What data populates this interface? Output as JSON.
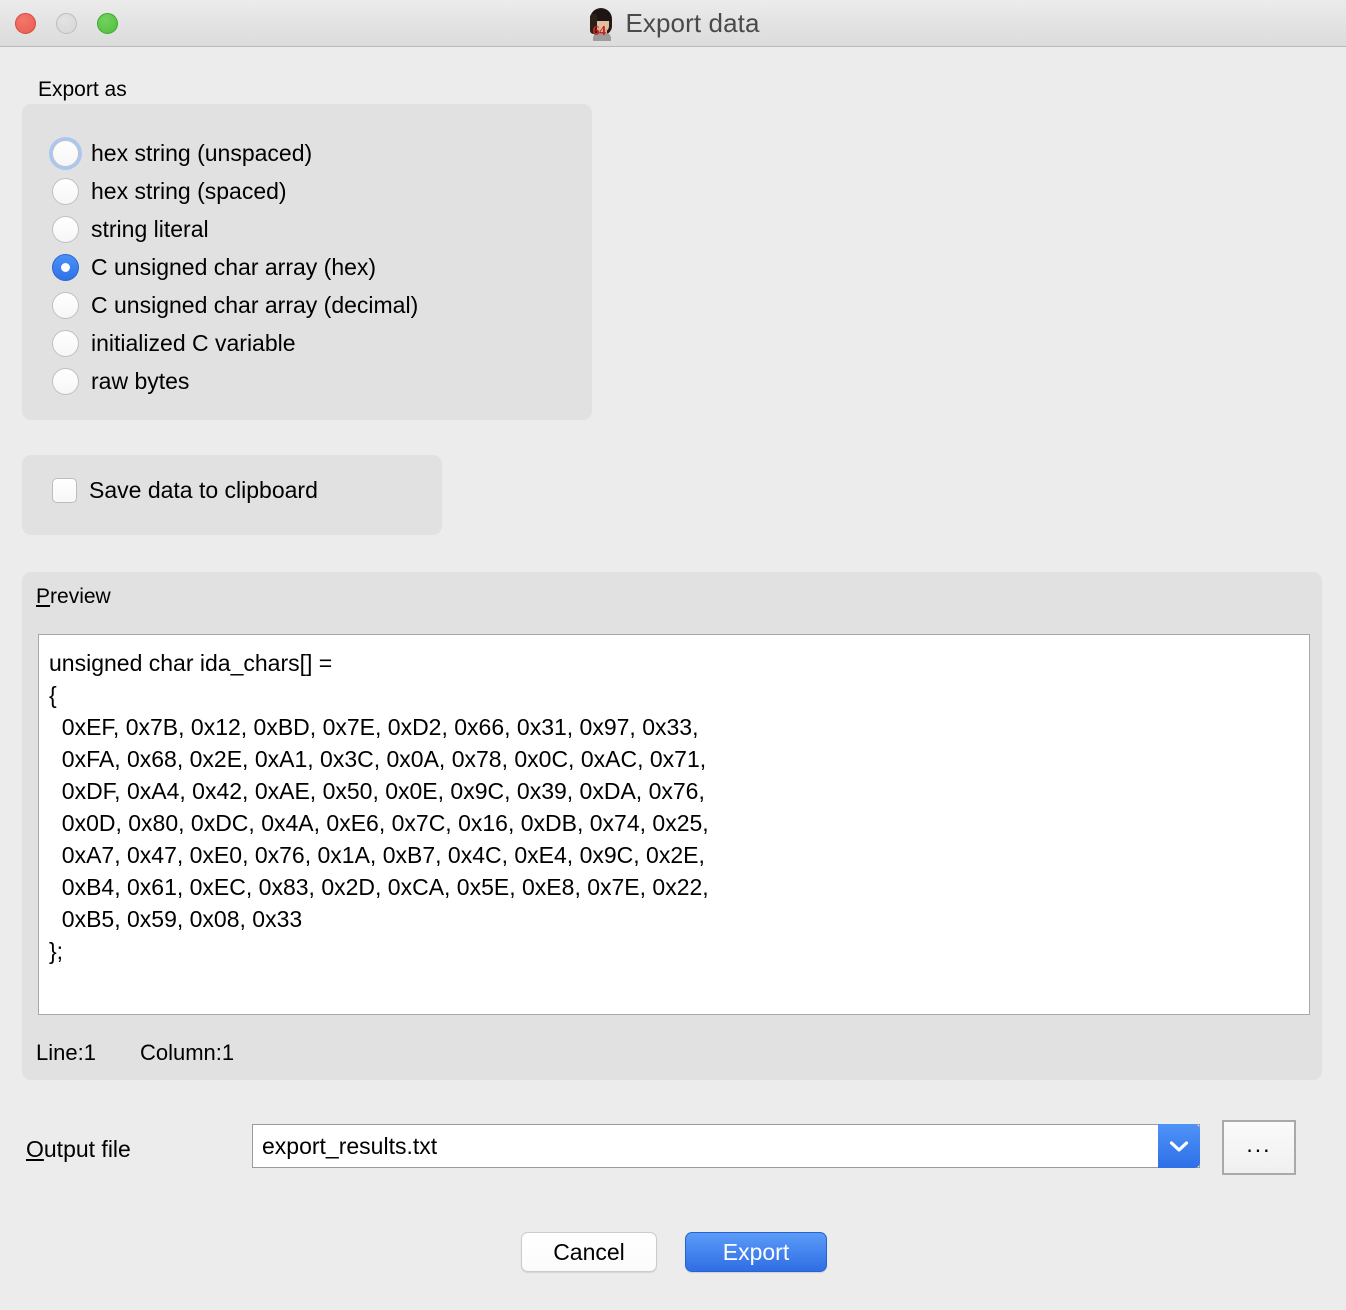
{
  "window": {
    "title": "Export data",
    "app_icon": "ida-woman-64-icon",
    "traffic_lights": {
      "close": "close-button",
      "minimize": "minimize-button",
      "zoom": "zoom-button"
    },
    "colors": {
      "window_background": "#ececec",
      "group_background": "#e1e1e1",
      "accent_blue": "#2f6ee4",
      "focus_ring": "#a9c7f2",
      "close_red": "#ea5b51",
      "zoom_green": "#4fbf3c",
      "minimize_gray": "#d6d6d6"
    }
  },
  "export_as": {
    "label": "Export as",
    "options": [
      {
        "label": "hex string (unspaced)",
        "selected": false,
        "focused": true
      },
      {
        "label": "hex string (spaced)",
        "selected": false,
        "focused": false
      },
      {
        "label": "string literal",
        "selected": false,
        "focused": false
      },
      {
        "label": "C unsigned char array (hex)",
        "selected": true,
        "focused": false
      },
      {
        "label": "C unsigned char array (decimal)",
        "selected": false,
        "focused": false
      },
      {
        "label": "initialized C variable",
        "selected": false,
        "focused": false
      },
      {
        "label": "raw bytes",
        "selected": false,
        "focused": false
      }
    ]
  },
  "clipboard": {
    "label": "Save data to clipboard",
    "checked": false
  },
  "preview": {
    "label_prefix": "P",
    "label_rest": "review",
    "text": "unsigned char ida_chars[] =\n{\n  0xEF, 0x7B, 0x12, 0xBD, 0x7E, 0xD2, 0x66, 0x31, 0x97, 0x33,\n  0xFA, 0x68, 0x2E, 0xA1, 0x3C, 0x0A, 0x78, 0x0C, 0xAC, 0x71,\n  0xDF, 0xA4, 0x42, 0xAE, 0x50, 0x0E, 0x9C, 0x39, 0xDA, 0x76,\n  0x0D, 0x80, 0xDC, 0x4A, 0xE6, 0x7C, 0x16, 0xDB, 0x74, 0x25,\n  0xA7, 0x47, 0xE0, 0x76, 0x1A, 0xB7, 0x4C, 0xE4, 0x9C, 0x2E,\n  0xB4, 0x61, 0xEC, 0x83, 0x2D, 0xCA, 0x5E, 0xE8, 0x7E, 0x22,\n  0xB5, 0x59, 0x08, 0x33\n};",
    "status_line": "Line:1",
    "status_column": "Column:1"
  },
  "output_file": {
    "label_prefix": "O",
    "label_rest": "utput file",
    "value": "export_results.txt",
    "placeholder": "",
    "dropdown_icon": "chevron-down-icon",
    "browse_label": "..."
  },
  "actions": {
    "cancel_label": "Cancel",
    "export_label": "Export"
  }
}
